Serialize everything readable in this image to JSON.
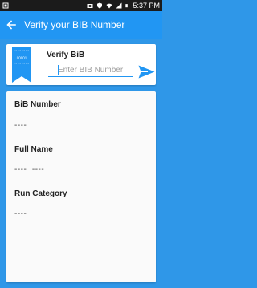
{
  "status_bar": {
    "time": "5:37 PM",
    "icons": [
      "notification-icon",
      "camera-icon",
      "shield-icon",
      "wifi-icon",
      "signal-icon",
      "battery-icon"
    ]
  },
  "toolbar": {
    "title": "Verify your BIB Number",
    "back_icon": "arrow-left-icon",
    "color": "#2196f3"
  },
  "verify_card": {
    "label": "Verify BiB",
    "ribbon_text": "00001",
    "input_placeholder": "Enter BIB Number",
    "input_value": "",
    "send_icon": "send-icon"
  },
  "details": {
    "fields": [
      {
        "label": "BiB Number",
        "value": "----"
      },
      {
        "label": "Full Name",
        "value": "----  ----"
      },
      {
        "label": "Run Category",
        "value": "----"
      }
    ]
  },
  "colors": {
    "background": "#2f97e8",
    "accent": "#2196f3",
    "statusbar": "#1b1b1b"
  }
}
